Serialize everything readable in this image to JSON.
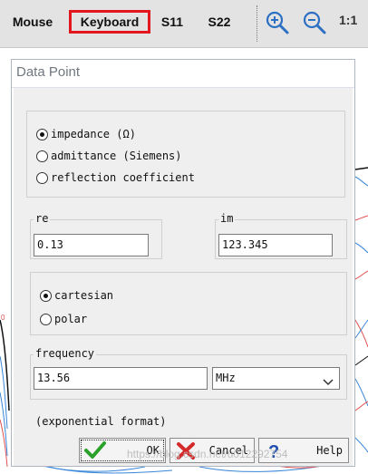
{
  "toolbar": {
    "mouse_label": "Mouse",
    "keyboard_label": "Keyboard",
    "s11_label": "S11",
    "s22_label": "S22",
    "zoom_reset_label": "1:1",
    "highlight_color": "#e3161d",
    "zoom_icon_color": "#2d6fc2"
  },
  "dialog": {
    "title": "Data Point",
    "representation": {
      "options": [
        {
          "label": "impedance (Ω)",
          "selected": true
        },
        {
          "label": "admittance (Siemens)",
          "selected": false
        },
        {
          "label": "reflection coefficient",
          "selected": false
        }
      ]
    },
    "re": {
      "label": "re",
      "value": "0.13"
    },
    "im": {
      "label": "im",
      "value": "123.345"
    },
    "coordinates": {
      "options": [
        {
          "label": "cartesian",
          "selected": true
        },
        {
          "label": "polar",
          "selected": false
        }
      ]
    },
    "frequency": {
      "label": "frequency",
      "value": "13.56",
      "unit": "MHz"
    },
    "hint": "(exponential format)",
    "buttons": {
      "ok": "OK",
      "cancel": "Cancel",
      "help": "Help"
    }
  },
  "watermark": "https://blog.csdn.net/u012292754"
}
